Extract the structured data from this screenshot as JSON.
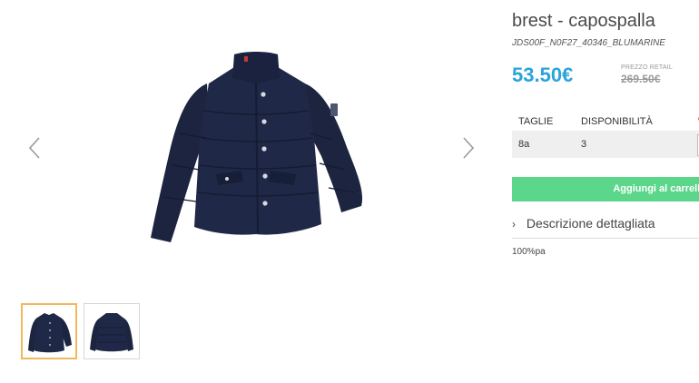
{
  "gallery": {
    "prev_icon": "chevron-left-icon",
    "next_icon": "chevron-right-icon",
    "main_image": "navy-puffer-jacket-front",
    "thumbnails": [
      "navy-puffer-jacket-front",
      "navy-puffer-jacket-back"
    ],
    "active_thumb_color": "#f1b95a"
  },
  "product": {
    "title": "brest - capospalla",
    "sku": "JDS00F_N0F27_40346_BLUMARINE",
    "price": "53.50€",
    "retail_label": "PREZZO RETAIL",
    "retail_price": "269.50€",
    "price_color": "#2aa3dd"
  },
  "sizes": {
    "headers": [
      "TAGLIE",
      "DISPONIBILITÀ"
    ],
    "rows": [
      {
        "size": "8a",
        "availability": "3"
      }
    ]
  },
  "cart": {
    "button_label": "Aggiungi al carrello",
    "button_color": "#5cd68b"
  },
  "description": {
    "toggle_label": "Descrizione dettagliata",
    "composition": "100%pa"
  }
}
